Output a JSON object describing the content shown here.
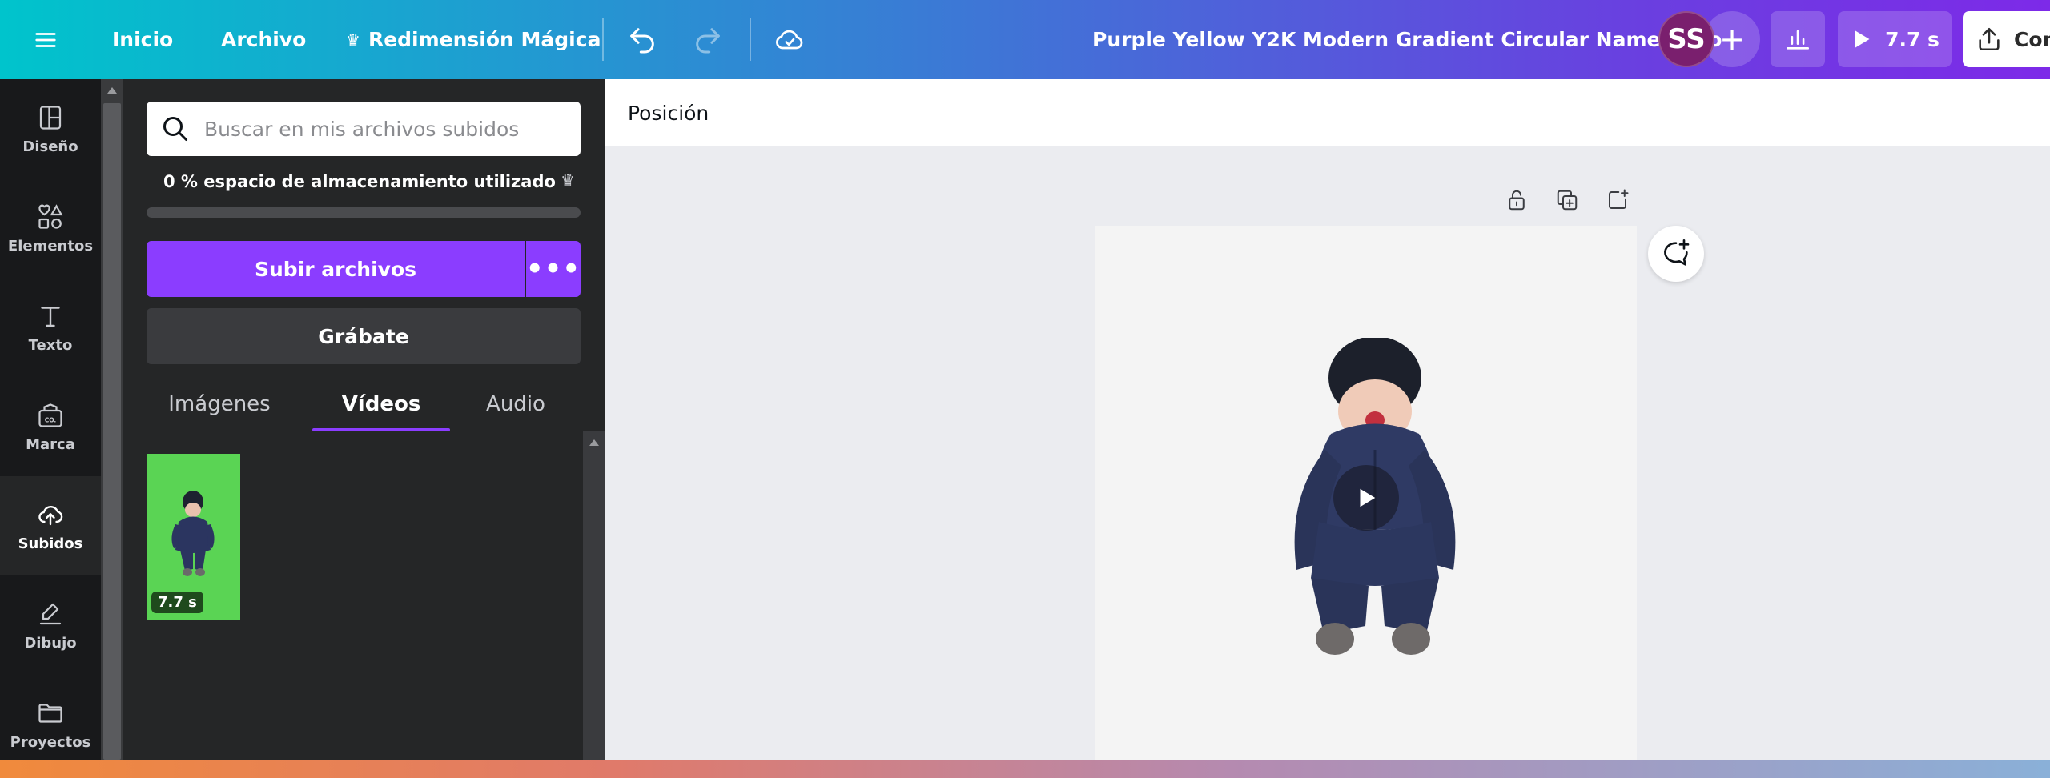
{
  "topbar": {
    "menu_inicio": "Inicio",
    "menu_archivo": "Archivo",
    "menu_magic": "Redimensión Mágica",
    "doc_title": "Purple Yellow Y2K Modern Gradient Circular Name Logo",
    "avatar_initials": "SS",
    "present_duration": "7.7 s",
    "share_label": "Con"
  },
  "rail": {
    "items": [
      {
        "label": "Diseño",
        "icon": "layout-icon"
      },
      {
        "label": "Elementos",
        "icon": "shapes-icon"
      },
      {
        "label": "Texto",
        "icon": "text-icon"
      },
      {
        "label": "Marca",
        "icon": "brand-icon"
      },
      {
        "label": "Subidos",
        "icon": "upload-cloud-icon",
        "active": true
      },
      {
        "label": "Dibujo",
        "icon": "draw-icon"
      },
      {
        "label": "Proyectos",
        "icon": "folder-icon"
      }
    ]
  },
  "panel": {
    "search_placeholder": "Buscar en mis archivos subidos",
    "storage_text": "0 % espacio de almacenamiento utilizado",
    "storage_used_percent": 0,
    "upload_label": "Subir archivos",
    "upload_more": "•••",
    "record_label": "Grábate",
    "tabs": [
      {
        "label": "Imágenes"
      },
      {
        "label": "Vídeos",
        "active": true
      },
      {
        "label": "Audio"
      }
    ],
    "videos": [
      {
        "duration": "7.7 s"
      }
    ]
  },
  "canvas": {
    "context_label": "Posición"
  },
  "colors": {
    "accent": "#8b3dff",
    "topbar_start": "#00c4cc",
    "topbar_end": "#7d2ae8",
    "video_bg": "#5ad454"
  }
}
